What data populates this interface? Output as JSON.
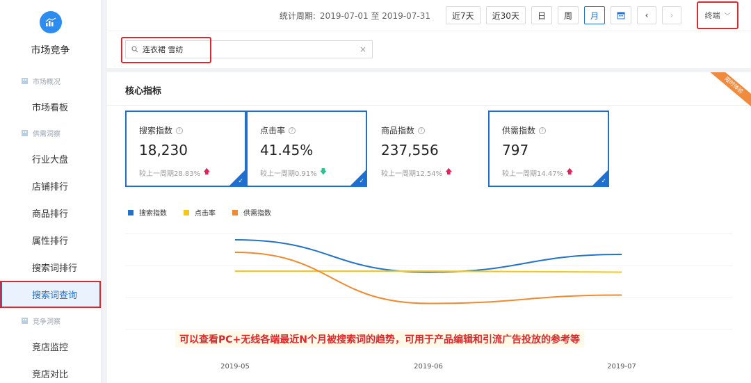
{
  "sidebar": {
    "title": "市场竞争",
    "groups": [
      {
        "label": "市场概况",
        "items": [
          {
            "label": "市场看板"
          }
        ]
      },
      {
        "label": "供需洞察",
        "items": [
          {
            "label": "行业大盘"
          },
          {
            "label": "店铺排行"
          },
          {
            "label": "商品排行"
          },
          {
            "label": "属性排行"
          },
          {
            "label": "搜索词排行"
          },
          {
            "label": "搜索词查询",
            "active": true
          }
        ]
      },
      {
        "label": "竞争洞察",
        "items": [
          {
            "label": "竞店监控"
          },
          {
            "label": "竞店对比"
          }
        ]
      }
    ]
  },
  "topbar": {
    "period_label": "统计周期:",
    "period_value": "2019-07-01 至 2019-07-31",
    "btn_7d": "近7天",
    "btn_30d": "近30天",
    "btn_day": "日",
    "btn_week": "周",
    "btn_month": "月",
    "device": "终端"
  },
  "search": {
    "value": "连衣裙 雪纺"
  },
  "panel": {
    "title": "核心指标",
    "ribbon": "限时体验"
  },
  "cards": [
    {
      "name": "搜索指数",
      "value": "18,230",
      "delta": "较上一周期28.83%",
      "trend": "up",
      "selected": true
    },
    {
      "name": "点击率",
      "value": "41.45%",
      "delta": "较上一周期0.91%",
      "trend": "down",
      "selected": true
    },
    {
      "name": "商品指数",
      "value": "237,556",
      "delta": "较上一周期12.54%",
      "trend": "up",
      "selected": false
    },
    {
      "name": "供需指数",
      "value": "797",
      "delta": "较上一周期14.47%",
      "trend": "up",
      "selected": true
    }
  ],
  "chart_data": {
    "type": "line",
    "x": [
      "2019-05",
      "2019-06",
      "2019-07"
    ],
    "series": [
      {
        "name": "搜索指数",
        "color": "#2273c8",
        "values": [
          0.86,
          0.55,
          0.72
        ]
      },
      {
        "name": "点击率",
        "color": "#f5c518",
        "values": [
          0.56,
          0.56,
          0.55
        ]
      },
      {
        "name": "供需指数",
        "color": "#ef8a2e",
        "values": [
          0.74,
          0.25,
          0.33
        ]
      }
    ]
  },
  "caption": "可以查看PC+无线各端最近N个月被搜索词的趋势，可用于产品编辑和引流广告投放的参考等",
  "colors": {
    "accent": "#1f6fd1",
    "highlight": "#e0252b",
    "up": "#e0245e",
    "down": "#2bbf8a"
  }
}
